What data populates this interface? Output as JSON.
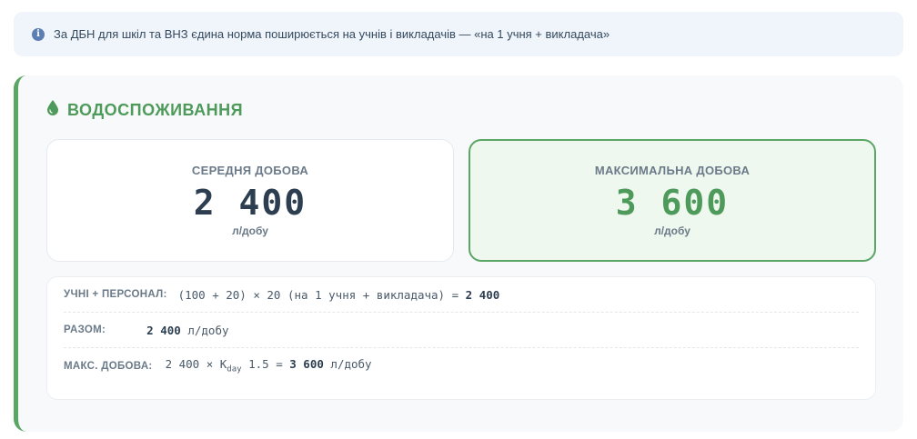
{
  "banner": {
    "icon": "info-icon",
    "text": "За ДБН для шкіл та ВНЗ єдина норма поширюється на учнів і викладачів — «на 1 учня + викладача»"
  },
  "section": {
    "icon": "water-drop-icon",
    "title": "ВОДОСПОЖИВАННЯ",
    "accent": "#5aa665"
  },
  "cards": {
    "average": {
      "label": "СЕРЕДНЯ ДОБОВА",
      "value": "2 400",
      "unit": "л/добу"
    },
    "maximum": {
      "label": "МАКСИМАЛЬНА ДОБОВА",
      "value": "3 600",
      "unit": "л/добу"
    }
  },
  "calc": {
    "row1": {
      "label": "УЧНІ + ПЕРСОНАЛ:",
      "expr": "(100 + 20) × 20 (на 1 учня + викладача) = ",
      "result": "2 400"
    },
    "row2": {
      "label": "РАЗОМ:",
      "value": "2 400",
      "unit": " л/добу"
    },
    "row3": {
      "label": "МАКС. ДОБОВА:",
      "expr_a": "2 400 × K",
      "sub": "day",
      "expr_b": " 1.5 = ",
      "result": "3 600",
      "unit": " л/добу"
    }
  }
}
